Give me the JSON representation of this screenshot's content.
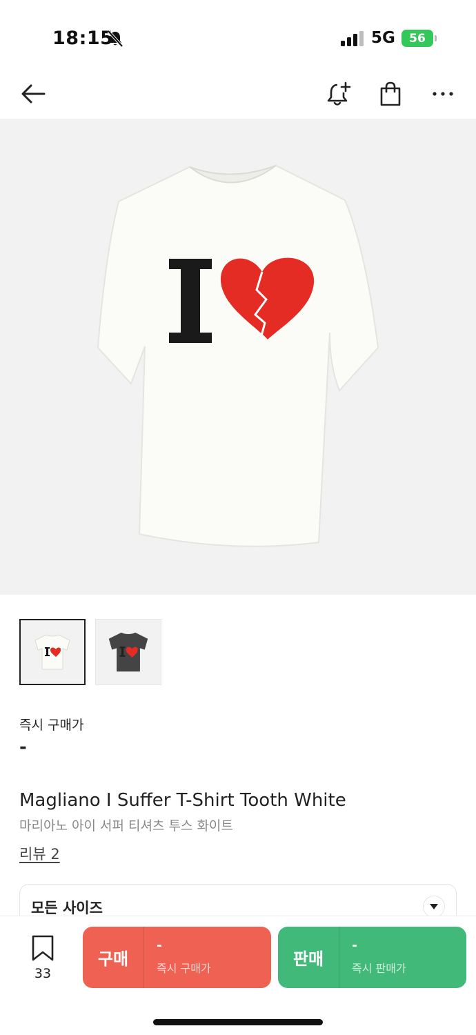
{
  "status_bar": {
    "time": "18:15",
    "network": "5G",
    "battery": "56"
  },
  "nav": {
    "back_icon": "back-arrow-icon",
    "alert_icon": "bell-plus-icon",
    "cart_icon": "shopping-bag-icon",
    "more_icon": "more-dots-icon"
  },
  "product": {
    "hero_image": "white t-shirt with I and broken heart print",
    "thumbnails": [
      {
        "color": "white",
        "active": true
      },
      {
        "color": "charcoal",
        "active": false
      }
    ],
    "instant_price_label": "즉시 구매가",
    "instant_price_value": "-",
    "title_en": "Magliano I Suffer T-Shirt Tooth White",
    "title_ko": "마리아노 아이 서퍼 티셔츠 투스 화이트",
    "review_link": "리뷰 2"
  },
  "size_select": {
    "label": "모든 사이즈"
  },
  "bottom_bar": {
    "wish_count": "33",
    "buy": {
      "label": "구매",
      "price": "-",
      "sub": "즉시 구매가",
      "color": "#ef6253"
    },
    "sell": {
      "label": "판매",
      "price": "-",
      "sub": "즉시 판매가",
      "color": "#41b979"
    }
  }
}
